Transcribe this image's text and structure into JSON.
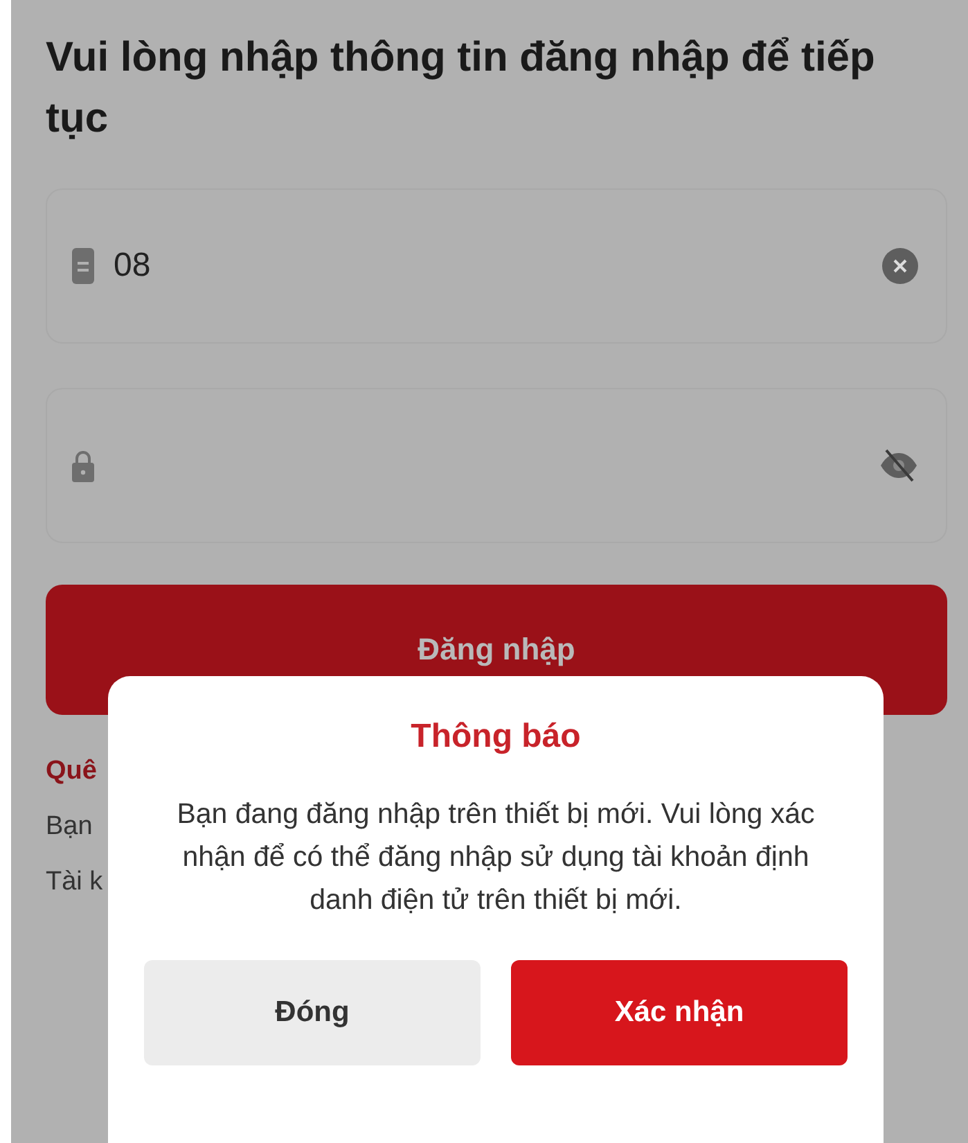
{
  "heading": "Vui lòng nhập thông tin đăng nhập để tiếp tục",
  "fields": [
    {
      "kind": "phone",
      "value": "08"
    },
    {
      "kind": "password"
    }
  ],
  "login_button": "Đăng nhập",
  "below_texts": [
    {
      "kind": "link",
      "text": "Quê"
    },
    {
      "kind": "text",
      "text": "Bạn"
    },
    {
      "kind": "text",
      "text": "Tài k"
    }
  ],
  "dialog": {
    "title": "Thông báo",
    "message": "Bạn đang đăng nhập trên thiết bị mới. Vui lòng xác nhận để có thể đăng nhập sử dụng tài khoản định danh điện tử trên thiết bị mới.",
    "buttons": [
      {
        "label": "Đóng",
        "kind": "secondary"
      },
      {
        "label": "Xác nhận",
        "kind": "primary"
      }
    ]
  }
}
